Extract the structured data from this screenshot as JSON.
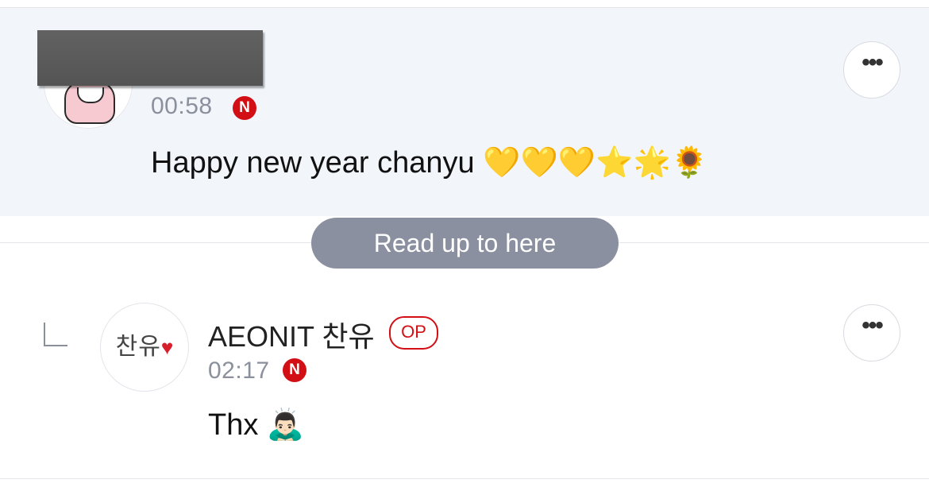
{
  "comments": [
    {
      "time": "00:58",
      "new_badge": "N",
      "text": "Happy new year chanyu 💛💛💛⭐🌟🌻",
      "more_label": "•••",
      "highlighted": true
    },
    {
      "author": "AEONIT 찬유",
      "author_badge": "OP",
      "avatar_text": "찬유",
      "time": "02:17",
      "new_badge": "N",
      "text": "Thx 🙇🏻‍♂️",
      "more_label": "•••",
      "is_reply": true
    }
  ],
  "read_marker": "Read up to here",
  "colors": {
    "highlight_bg": "#f2f6fb",
    "new_badge": "#d20f14",
    "op_badge": "#d20f14",
    "pill_bg": "#8b90a0",
    "timestamp": "#8a909c"
  }
}
